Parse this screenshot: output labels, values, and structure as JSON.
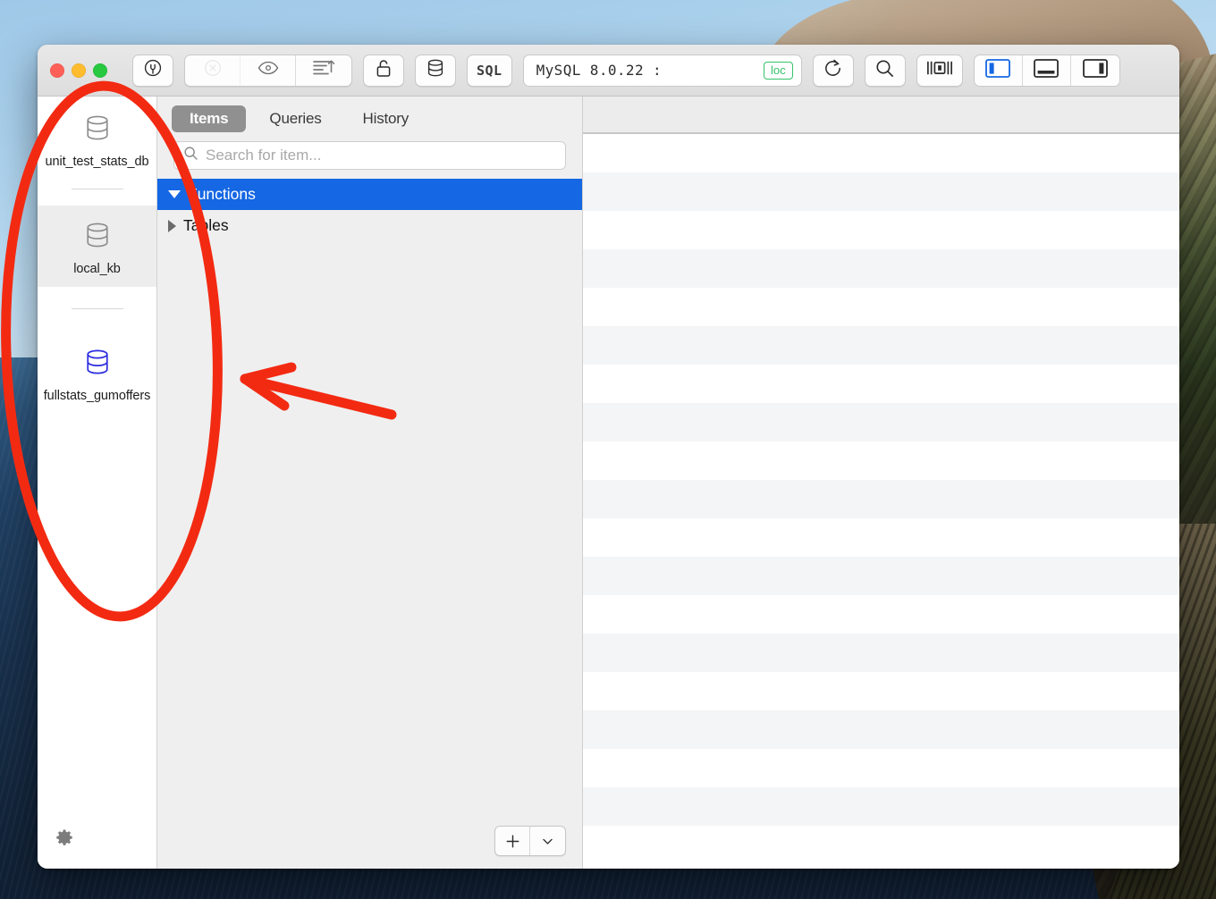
{
  "window": {
    "traffic_lights": [
      "close",
      "minimize",
      "maximize"
    ]
  },
  "toolbar": {
    "connect_icon": "plug-circle-icon",
    "stop_icon": "x-circle-icon",
    "preview_icon": "eye-icon",
    "sort_icon": "list-sort-up-icon",
    "lock_icon": "padlock-icon",
    "database_icon": "database-icon",
    "sql_label": "SQL",
    "version_value": "MySQL 8.0.22 :",
    "location_badge": "loc",
    "refresh_icon": "refresh-icon",
    "search_icon": "search-icon",
    "panels_icon": "panels-icon",
    "view_left_icon": "sidebar-left-icon",
    "view_bottom_icon": "panel-bottom-icon",
    "view_right_icon": "sidebar-right-icon",
    "accent_color": "#1567e3",
    "badge_color": "#35c26a"
  },
  "sidebar": {
    "databases": [
      {
        "name": "unit_test_stats_db",
        "icon": "database-icon",
        "icon_color": "#8a8a8a",
        "state": "selected",
        "has_separator_below": true
      },
      {
        "name": "local_kb",
        "icon": "database-icon",
        "icon_color": "#8a8a8a",
        "state": "hover",
        "has_separator_below": false
      },
      {
        "name": "fullstats_gumoffers",
        "icon": "database-icon",
        "icon_color": "#2a2ae0",
        "state": "normal",
        "has_separator_above": true
      }
    ],
    "settings_icon": "gear-icon"
  },
  "middle": {
    "tabs": [
      {
        "label": "Items",
        "active": true
      },
      {
        "label": "Queries",
        "active": false
      },
      {
        "label": "History",
        "active": false
      }
    ],
    "search": {
      "placeholder": "Search for item...",
      "value": "",
      "icon": "search-icon"
    },
    "tree": [
      {
        "label": "Functions",
        "expanded": true,
        "selected": true
      },
      {
        "label": "Tables",
        "expanded": false,
        "selected": false
      }
    ],
    "footer": {
      "add_label": "+",
      "menu_icon": "chevron-down-icon"
    }
  },
  "content": {
    "row_count": 19
  },
  "annotations": {
    "ellipse_color": "#f32a12",
    "arrow_color": "#f32a12",
    "shapes": [
      "ellipse-highlight-sidebar",
      "arrow-pointing-left"
    ]
  }
}
